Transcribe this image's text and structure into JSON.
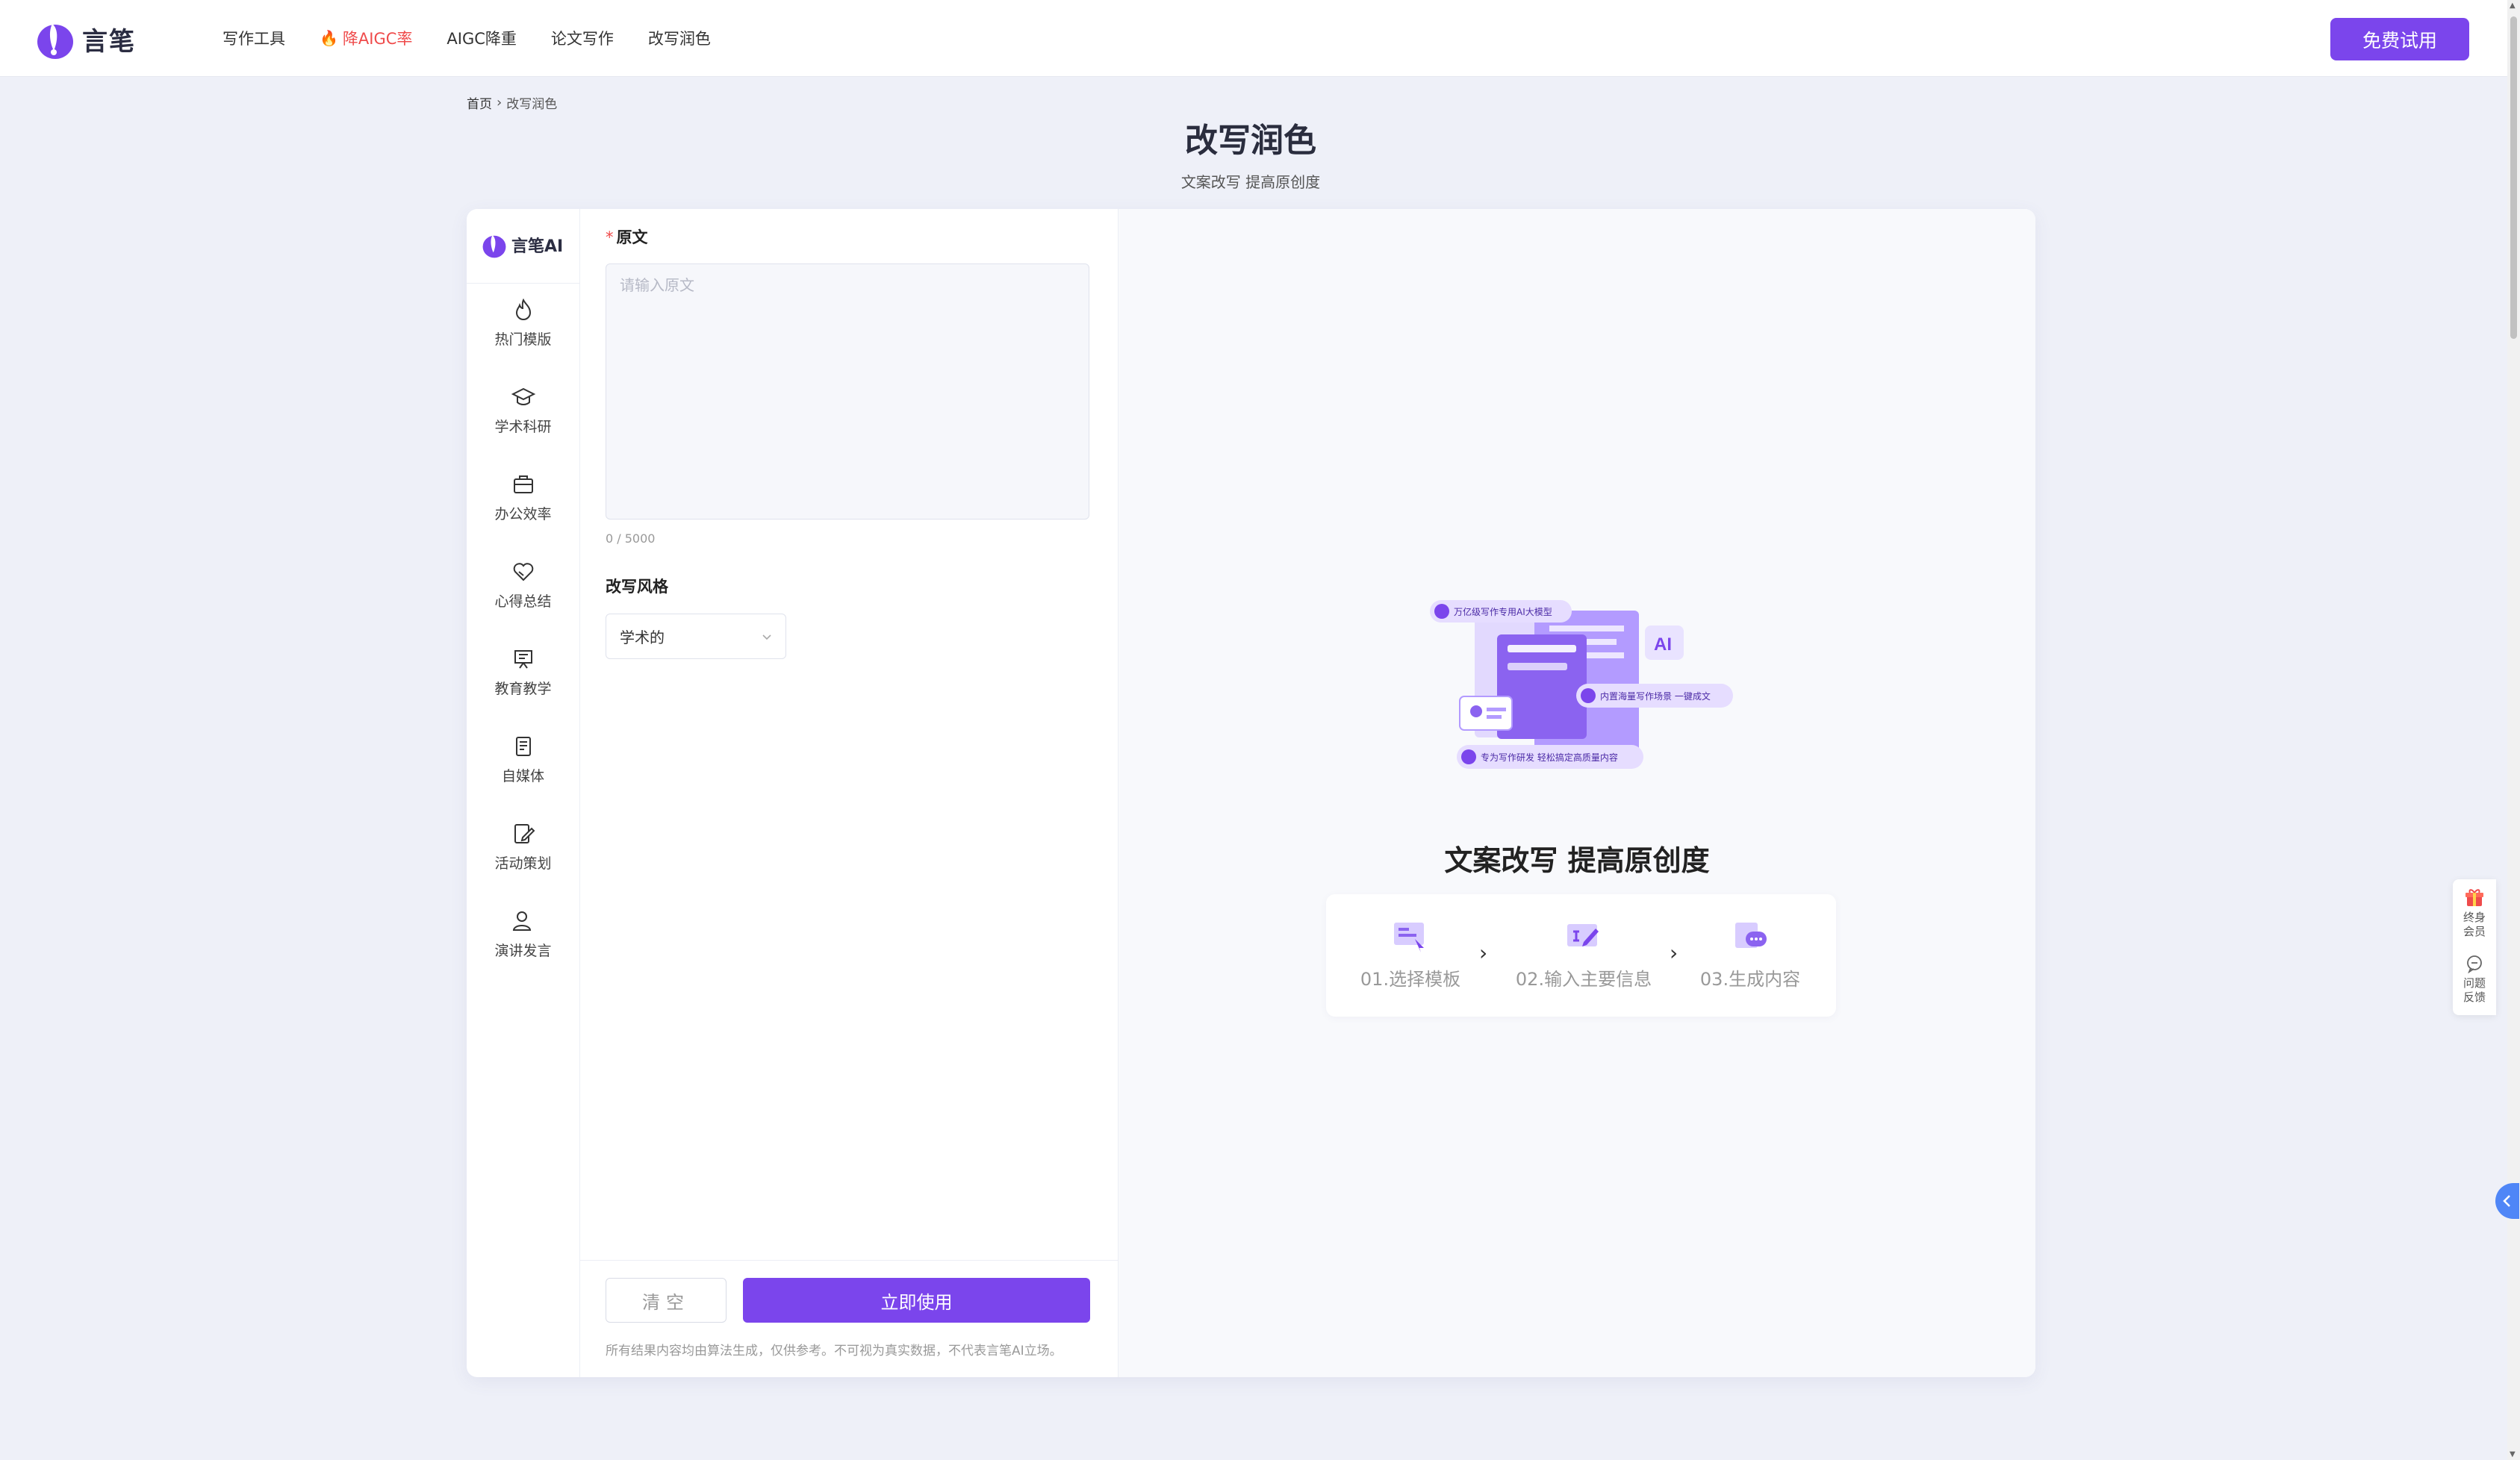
{
  "header": {
    "logo_text": "言笔",
    "nav": [
      {
        "label": "写作工具",
        "hot": false
      },
      {
        "label": "降AIGC率",
        "hot": true
      },
      {
        "label": "AIGC降重",
        "hot": false
      },
      {
        "label": "论文写作",
        "hot": false
      },
      {
        "label": "改写润色",
        "hot": false
      }
    ],
    "cta": "免费试用"
  },
  "breadcrumb": {
    "home": "首页",
    "current": "改写润色"
  },
  "page": {
    "title": "改写润色",
    "subtitle": "文案改写 提高原创度"
  },
  "rail": {
    "logo_text": "言笔AI",
    "items": [
      {
        "label": "热门模版",
        "icon": "fire-icon"
      },
      {
        "label": "学术科研",
        "icon": "graduation-cap-icon"
      },
      {
        "label": "办公效率",
        "icon": "briefcase-icon"
      },
      {
        "label": "心得总结",
        "icon": "heart-hand-icon"
      },
      {
        "label": "教育教学",
        "icon": "presentation-icon"
      },
      {
        "label": "自媒体",
        "icon": "document-icon"
      },
      {
        "label": "活动策划",
        "icon": "edit-doc-icon"
      },
      {
        "label": "演讲发言",
        "icon": "speaker-icon"
      }
    ]
  },
  "form": {
    "source_label": "原文",
    "source_placeholder": "请输入原文",
    "source_value": "",
    "counter": "0 / 5000",
    "style_label": "改写风格",
    "style_value": "学术的",
    "clear_label": "清空",
    "use_label": "立即使用",
    "disclaimer": "所有结果内容均由算法生成，仅供参考。不可视为真实数据，不代表言笔AI立场。"
  },
  "preview": {
    "illus_badges": [
      "万亿级写作专用AI大模型",
      "内置海量写作场景 一键成文",
      "专为写作研发 轻松搞定高质量内容"
    ],
    "illus_ai": "AI",
    "title": "文案改写 提高原创度",
    "steps": [
      "01.选择模板",
      "02.输入主要信息",
      "03.生成内容"
    ]
  },
  "floating": {
    "vip": "终身会员",
    "feedback": "问题反馈"
  },
  "colors": {
    "accent": "#7b45ec",
    "hot": "#ef4b4b",
    "background": "#eef0f8"
  }
}
